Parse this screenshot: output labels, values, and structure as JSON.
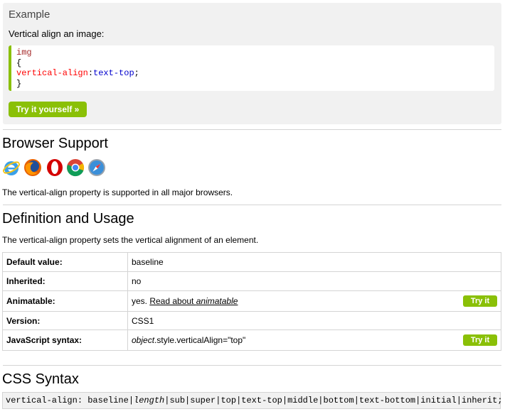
{
  "example": {
    "title": "Example",
    "description": "Vertical align an image:",
    "code": {
      "selector": "img",
      "open_brace": "{",
      "property": "vertical-align",
      "colon": ":",
      "value": "text-top",
      "semicolon": ";",
      "close_brace": "}"
    },
    "try_button": "Try it yourself »"
  },
  "browser_support": {
    "heading": "Browser Support",
    "browsers": [
      {
        "icon": "internet-explorer-icon"
      },
      {
        "icon": "firefox-icon"
      },
      {
        "icon": "opera-icon"
      },
      {
        "icon": "chrome-icon"
      },
      {
        "icon": "safari-icon"
      }
    ],
    "note": "The vertical-align property is supported in all major browsers."
  },
  "definition": {
    "heading": "Definition and Usage",
    "text": "The vertical-align property sets the vertical alignment of an element.",
    "rows": [
      {
        "key": "Default value:",
        "value": "baseline"
      },
      {
        "key": "Inherited:",
        "value": "no"
      },
      {
        "key": "Animatable:",
        "value_prefix": "yes. ",
        "link_text": "Read about ",
        "link_em": "animatable",
        "try": "Try it"
      },
      {
        "key": "Version:",
        "value": "CSS1"
      },
      {
        "key": "JavaScript syntax:",
        "value_em": "object",
        "value_rest": ".style.verticalAlign=\"top\"",
        "try": "Try it"
      }
    ]
  },
  "css_syntax": {
    "heading": "CSS Syntax",
    "prefix": "vertical-align: baseline|",
    "em": "length",
    "suffix": "|sub|super|top|text-top|middle|bottom|text-bottom|initial|inherit;"
  }
}
